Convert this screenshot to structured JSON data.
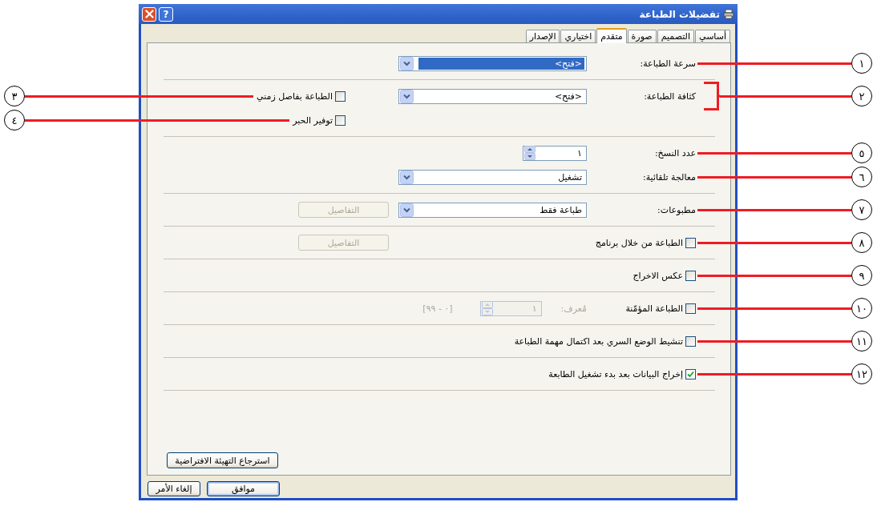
{
  "window": {
    "title": "تفضيلات الطباعة",
    "help_label": "?",
    "tabs": [
      {
        "label": "أساسي",
        "selected": false
      },
      {
        "label": "التصميم",
        "selected": false
      },
      {
        "label": "صورة",
        "selected": false
      },
      {
        "label": "متقدم",
        "selected": true
      },
      {
        "label": "اختياري",
        "selected": false
      },
      {
        "label": "الإصدار",
        "selected": false
      }
    ],
    "sections": [
      {
        "rows": [
          {
            "label": "سرعة الطباعة:",
            "control": {
              "kind": "dropdown",
              "value": "<فتح>",
              "highlighted": true
            },
            "callout": {
              "number": "١"
            }
          }
        ]
      },
      {
        "rows": [
          {
            "label": "كثافة الطباعة:",
            "control": {
              "kind": "dropdown",
              "value": "<فتح>",
              "highlighted": false
            },
            "side_checkbox": {
              "label": "الطباعة بفاصل زمني",
              "checked": false,
              "callout": {
                "number": "٣"
              }
            },
            "callout": {
              "number": "٢",
              "bracket": true
            }
          },
          {
            "side_checkbox": {
              "label": "توفير الحبر",
              "checked": false,
              "callout": {
                "number": "٤"
              }
            }
          }
        ]
      },
      {
        "rows": [
          {
            "label": "عدد النسخ:",
            "control": {
              "kind": "spin",
              "value": "١",
              "disabled": false
            },
            "callout": {
              "number": "٥"
            }
          },
          {
            "label": "معالجة تلقائية:",
            "control": {
              "kind": "dropdown",
              "value": "تشغيل",
              "highlighted": false
            },
            "callout": {
              "number": "٦"
            }
          }
        ]
      },
      {
        "rows": [
          {
            "label": "مطبوعات:",
            "control": {
              "kind": "dropdown",
              "value": "طباعة فقط",
              "highlighted": false
            },
            "button": {
              "label": "التفاصيل",
              "disabled": true
            },
            "callout": {
              "number": "٧"
            }
          }
        ]
      },
      {
        "rows": [
          {
            "checkbox": {
              "label": "الطباعة من خلال برنامج",
              "checked": false
            },
            "button": {
              "label": "التفاصيل",
              "disabled": true
            },
            "callout": {
              "number": "٨"
            }
          }
        ]
      },
      {
        "rows": [
          {
            "checkbox": {
              "label": "عكس الاخراج",
              "checked": false
            },
            "callout": {
              "number": "٩"
            }
          }
        ]
      },
      {
        "rows": [
          {
            "checkbox": {
              "label": "الطباعة المؤمّنة",
              "checked": false
            },
            "control": {
              "kind": "id-field",
              "label": "مُعرف:",
              "value": "١",
              "range": "[٠ - ٩٩]",
              "disabled": true
            },
            "callout": {
              "number": "١٠"
            }
          }
        ]
      },
      {
        "rows": [
          {
            "checkbox": {
              "label": "تنشيط الوضع السري بعد اكتمال مهمة الطباعة",
              "checked": false
            },
            "callout": {
              "number": "١١"
            }
          }
        ]
      },
      {
        "rows": [
          {
            "checkbox": {
              "label": "إخراج البيانات بعد بدء تشغيل الطابعة",
              "checked": true
            },
            "callout": {
              "number": "١٢"
            }
          }
        ]
      }
    ],
    "restore_button": "استرجاع التهيئة الافتراضية",
    "buttons": [
      {
        "label": "موافق",
        "default": true
      },
      {
        "label": "إلغاء الأمر",
        "default": false
      }
    ]
  }
}
